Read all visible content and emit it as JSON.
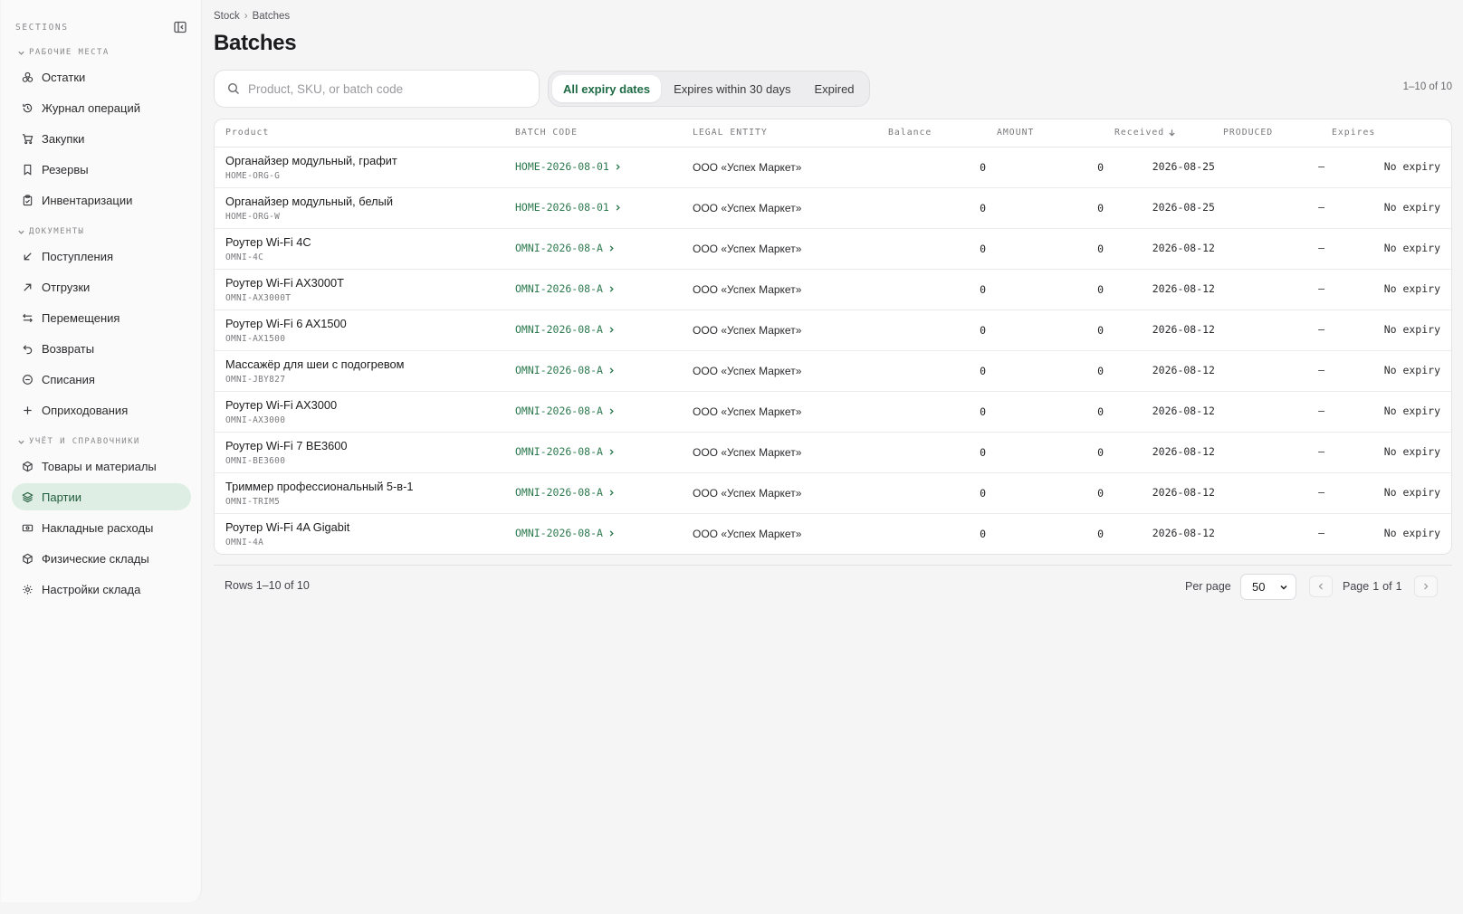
{
  "sidebar": {
    "header": "SECTIONS",
    "groups": [
      {
        "label": "РАБОЧИЕ МЕСТА",
        "items": [
          {
            "label": "Остатки",
            "icon": "boxes-icon"
          },
          {
            "label": "Журнал операций",
            "icon": "history-icon"
          },
          {
            "label": "Закупки",
            "icon": "cart-icon"
          },
          {
            "label": "Резервы",
            "icon": "bookmark-icon"
          },
          {
            "label": "Инвентаризации",
            "icon": "clipboard-check-icon"
          }
        ]
      },
      {
        "label": "ДОКУМЕНТЫ",
        "items": [
          {
            "label": "Поступления",
            "icon": "arrow-down-left-icon"
          },
          {
            "label": "Отгрузки",
            "icon": "arrow-up-right-icon"
          },
          {
            "label": "Перемещения",
            "icon": "arrows-swap-icon"
          },
          {
            "label": "Возвраты",
            "icon": "undo-icon"
          },
          {
            "label": "Списания",
            "icon": "minus-circle-icon"
          },
          {
            "label": "Оприходования",
            "icon": "plus-icon"
          }
        ]
      },
      {
        "label": "УЧЁТ И СПРАВОЧНИКИ",
        "items": [
          {
            "label": "Товары и материалы",
            "icon": "package-icon"
          },
          {
            "label": "Партии",
            "icon": "layers-icon",
            "active": true
          },
          {
            "label": "Накладные расходы",
            "icon": "banknote-icon"
          },
          {
            "label": "Физические склады",
            "icon": "warehouse-icon"
          },
          {
            "label": "Настройки склада",
            "icon": "gear-icon"
          }
        ]
      }
    ]
  },
  "breadcrumb": {
    "parent": "Stock",
    "separator": "›",
    "current": "Batches"
  },
  "page": {
    "title": "Batches"
  },
  "search": {
    "placeholder": "Product, SKU, or batch code",
    "value": ""
  },
  "filters": {
    "all": "All expiry dates",
    "soon": "Expires within 30 days",
    "expired": "Expired",
    "active": "all"
  },
  "range_label": "1–10 of 10",
  "table": {
    "headers": {
      "product": "Product",
      "batch_code": "BATCH CODE",
      "legal_entity": "LEGAL ENTITY",
      "balance": "Balance",
      "amount": "AMOUNT",
      "received": "Received",
      "produced": "PRODUCED",
      "expires": "Expires"
    },
    "rows": [
      {
        "name": "Органайзер модульный, графит",
        "sku": "HOME-ORG-G",
        "batch": "HOME-2026-08-01",
        "legal": "ООО «Успех Маркет»",
        "balance": "0",
        "amount": "0",
        "received": "2026-08-25",
        "produced": "—",
        "expires": "No expiry"
      },
      {
        "name": "Органайзер модульный, белый",
        "sku": "HOME-ORG-W",
        "batch": "HOME-2026-08-01",
        "legal": "ООО «Успех Маркет»",
        "balance": "0",
        "amount": "0",
        "received": "2026-08-25",
        "produced": "—",
        "expires": "No expiry"
      },
      {
        "name": "Роутер Wi-Fi 4C",
        "sku": "OMNI-4C",
        "batch": "OMNI-2026-08-A",
        "legal": "ООО «Успех Маркет»",
        "balance": "0",
        "amount": "0",
        "received": "2026-08-12",
        "produced": "—",
        "expires": "No expiry"
      },
      {
        "name": "Роутер Wi-Fi AX3000T",
        "sku": "OMNI-AX3000T",
        "batch": "OMNI-2026-08-A",
        "legal": "ООО «Успех Маркет»",
        "balance": "0",
        "amount": "0",
        "received": "2026-08-12",
        "produced": "—",
        "expires": "No expiry"
      },
      {
        "name": "Роутер Wi-Fi 6 AX1500",
        "sku": "OMNI-AX1500",
        "batch": "OMNI-2026-08-A",
        "legal": "ООО «Успех Маркет»",
        "balance": "0",
        "amount": "0",
        "received": "2026-08-12",
        "produced": "—",
        "expires": "No expiry"
      },
      {
        "name": "Массажёр для шеи с подогревом",
        "sku": "OMNI-JBY827",
        "batch": "OMNI-2026-08-A",
        "legal": "ООО «Успех Маркет»",
        "balance": "0",
        "amount": "0",
        "received": "2026-08-12",
        "produced": "—",
        "expires": "No expiry"
      },
      {
        "name": "Роутер Wi-Fi AX3000",
        "sku": "OMNI-AX3000",
        "batch": "OMNI-2026-08-A",
        "legal": "ООО «Успех Маркет»",
        "balance": "0",
        "amount": "0",
        "received": "2026-08-12",
        "produced": "—",
        "expires": "No expiry"
      },
      {
        "name": "Роутер Wi-Fi 7 BE3600",
        "sku": "OMNI-BE3600",
        "batch": "OMNI-2026-08-A",
        "legal": "ООО «Успех Маркет»",
        "balance": "0",
        "amount": "0",
        "received": "2026-08-12",
        "produced": "—",
        "expires": "No expiry"
      },
      {
        "name": "Триммер профессиональный 5-в-1",
        "sku": "OMNI-TRIM5",
        "batch": "OMNI-2026-08-A",
        "legal": "ООО «Успех Маркет»",
        "balance": "0",
        "amount": "0",
        "received": "2026-08-12",
        "produced": "—",
        "expires": "No expiry"
      },
      {
        "name": "Роутер Wi-Fi 4A Gigabit",
        "sku": "OMNI-4A",
        "batch": "OMNI-2026-08-A",
        "legal": "ООО «Успех Маркет»",
        "balance": "0",
        "amount": "0",
        "received": "2026-08-12",
        "produced": "—",
        "expires": "No expiry"
      }
    ]
  },
  "footer": {
    "rows_label": "Rows 1–10 of 10",
    "per_page_label": "Per page",
    "per_page_value": "50",
    "page_word": "Page",
    "page_current": "1",
    "page_of": "of",
    "page_total": "1"
  },
  "colors": {
    "accent": "#2d7a4f",
    "active_bg": "#dfeee4"
  }
}
